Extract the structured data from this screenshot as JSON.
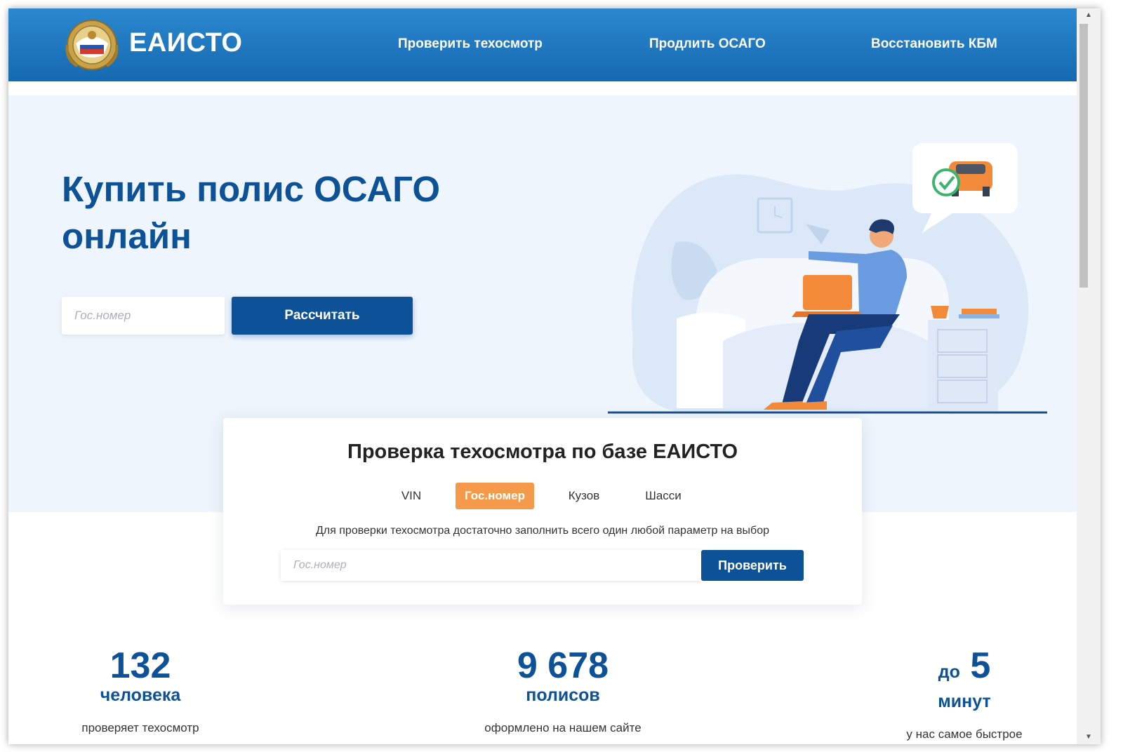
{
  "header": {
    "brand": "ЕАИСТО",
    "nav": [
      {
        "label": "Проверить техосмотр"
      },
      {
        "label": "Продлить ОСАГО"
      },
      {
        "label": "Восстановить КБМ"
      }
    ]
  },
  "hero": {
    "title": "Купить полис ОСАГО онлайн",
    "input_placeholder": "Гос.номер",
    "button_label": "Рассчитать"
  },
  "check": {
    "title": "Проверка техосмотра по базе ЕАИСТО",
    "tabs": [
      {
        "label": "VIN"
      },
      {
        "label": "Гос.номер"
      },
      {
        "label": "Кузов"
      },
      {
        "label": "Шасси"
      }
    ],
    "active_tab": "Гос.номер",
    "hint": "Для проверки техосмотра достаточно заполнить всего один любой параметр на выбор",
    "input_placeholder": "Гос.номер",
    "button_label": "Проверить"
  },
  "stats": [
    {
      "number": "132",
      "unit": "человека",
      "desc": "проверяет техосмотр"
    },
    {
      "number": "9 678",
      "unit": "полисов",
      "desc": "оформлено на нашем сайте"
    },
    {
      "prefix": "до",
      "number": "5",
      "unit": "минут",
      "desc": "у нас самое быстрое"
    }
  ],
  "colors": {
    "header_start": "#2b88cf",
    "header_end": "#1669b0",
    "primary": "#0d5196",
    "accent": "#f59a4a",
    "hero_bg": "#eef5fc"
  },
  "icons": {
    "logo": "emblem-icon",
    "scroll_up": "arrow-up-icon",
    "scroll_down": "arrow-down-icon"
  }
}
